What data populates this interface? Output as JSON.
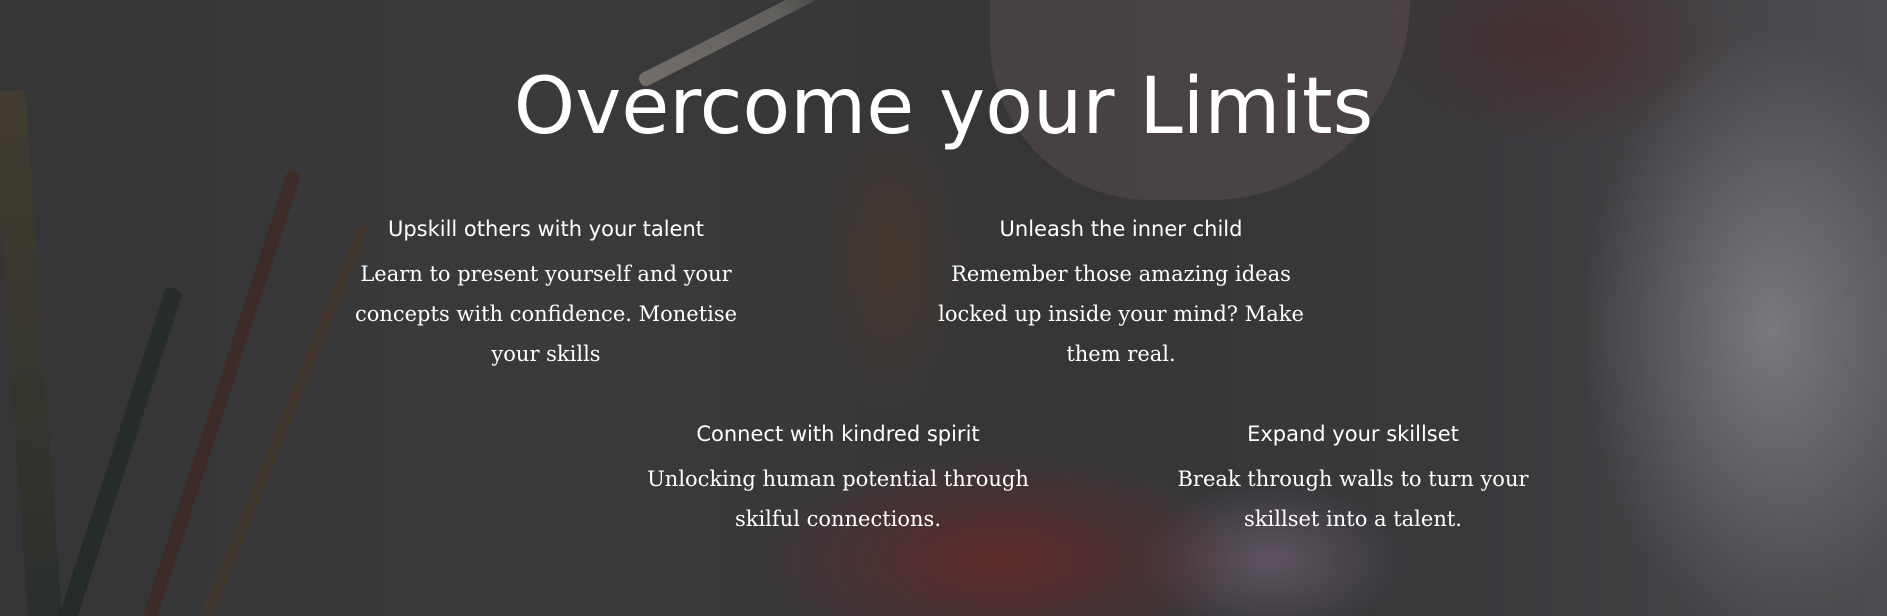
{
  "hero": {
    "title": "Overcome your Limits"
  },
  "features": [
    {
      "heading": "Upskill others with your talent",
      "description": "Learn to present yourself and your concepts with confidence. Monetise your skills"
    },
    {
      "heading": "Unleash the inner child",
      "description": "Remember those amazing ideas locked up inside your mind? Make them real."
    },
    {
      "heading": "Connect with kindred spirit",
      "description": "Unlocking human potential through skilful connections."
    },
    {
      "heading": "Expand your skillset",
      "description": "Break through walls to turn your skillset into a talent."
    }
  ],
  "colors": {
    "text": "#ffffff",
    "overlay": "#000000"
  }
}
